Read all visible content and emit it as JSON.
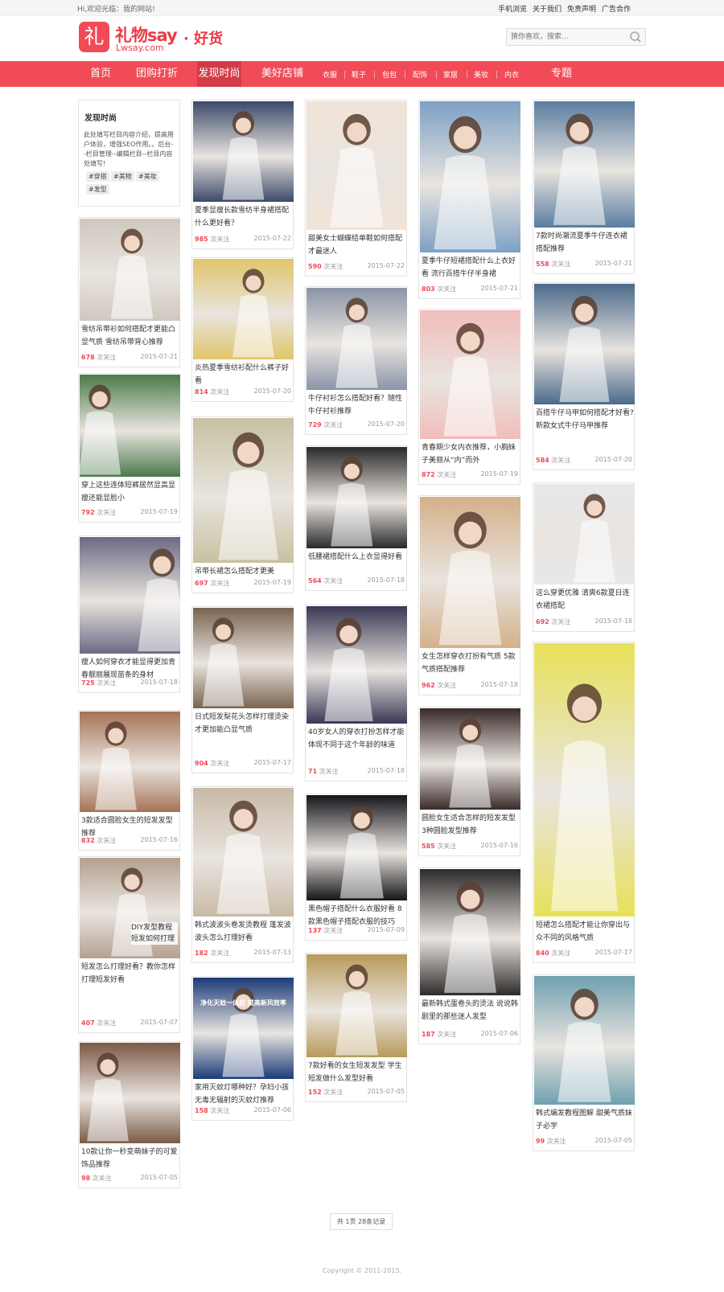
{
  "topbar": {
    "welcome": "Hi,欢迎光临：我的网站!",
    "links": [
      "手机浏览",
      "关于我们",
      "免责声明",
      "广告合作"
    ]
  },
  "header": {
    "logo_char": "礼",
    "logo_main": "礼物say",
    "logo_sub": "· 好货",
    "logo_domain": "Lwsay.com",
    "search_placeholder": "猜你喜欢，搜索...",
    "colors": {
      "brand": "#f04b57",
      "accent": "#d33c46"
    }
  },
  "nav": {
    "home": "首页",
    "group": "团购打折",
    "discover": "发现时尚",
    "shops": "美好店铺",
    "cats": [
      "衣服",
      "鞋子",
      "包包",
      "配饰",
      "家居",
      "美妆",
      "内衣"
    ],
    "special": "专题"
  },
  "sidebar": {
    "title": "发现时尚",
    "desc": "此处填写栏目内容介绍，提高用户体验，增强SEO作用。。后台--栏目管理--编辑栏目--栏目内容处填写!",
    "tags": [
      "#穿搭",
      "#美物",
      "#美妆",
      "#发型"
    ]
  },
  "unit": "次关注",
  "feed": {
    "col1": [
      {
        "title": "雪纺吊带衫如何搭配才更能凸显气质 雪纺吊带背心推荐",
        "count": "678",
        "date": "2015-07-21"
      },
      {
        "title": "穿上这些连体短裤居然显高显瘦还能显脸小",
        "count": "792",
        "date": "2015-07-19"
      },
      {
        "title": "瘦人如何穿衣才能显得更加青春靓丽展现苗条的身材",
        "count": "725",
        "date": "2015-07-18"
      },
      {
        "title": "3款适合圆脸女生的短发发型推荐",
        "count": "832",
        "date": "2015-07-16"
      },
      {
        "title": "短发怎么打理好看？教你怎样打理短发好看",
        "count": "407",
        "date": "2015-07-07",
        "overlay": "DIY发型教程 短发如何打理"
      },
      {
        "title": "10款让你一秒变萌妹子的可爱饰品推荐",
        "count": "98",
        "date": "2015-07-05"
      }
    ],
    "col2": [
      {
        "title": "夏季显瘦长款雪纺半身裙搭配什么更好看？",
        "count": "985",
        "date": "2015-07-22"
      },
      {
        "title": "炎热夏季雪纺衫配什么裤子好看",
        "count": "814",
        "date": "2015-07-20"
      },
      {
        "title": "吊带长裙怎么搭配才更美",
        "count": "697",
        "date": "2015-07-19"
      },
      {
        "title": "日式短发梨花头怎样打理烫染才更加能凸显气质",
        "count": "904",
        "date": "2015-07-17"
      },
      {
        "title": "韩式波波头卷发烫教程 蓬发波波头怎么打理好看",
        "count": "182",
        "date": "2015-07-13"
      },
      {
        "title": "家用灭蚊灯哪种好？孕妇小孩无毒无辐射的灭蚊灯推荐",
        "count": "158",
        "date": "2015-07-06",
        "ad_text": "净化灭蚊一体机 提高新风效率"
      }
    ],
    "col3": [
      {
        "title": "甜美女士蝴蝶结单鞋如何搭配才最迷人",
        "count": "590",
        "date": "2015-07-22"
      },
      {
        "title": "牛仔衬衫怎么搭配好看？随性牛仔衬衫推荐",
        "count": "729",
        "date": "2015-07-20"
      },
      {
        "title": "低腰裙搭配什么上衣显得好看",
        "count": "564",
        "date": "2015-07-18"
      },
      {
        "title": "40岁女人的穿衣打扮怎样才能体现不同于这个年龄的味道",
        "count": "71",
        "date": "2015-07-18"
      },
      {
        "title": "黑色帽子搭配什么衣服好看 8款黑色帽子搭配衣服的技巧",
        "count": "137",
        "date": "2015-07-09"
      },
      {
        "title": "7款好看的女生短发发型 学生短发做什么发型好看",
        "count": "152",
        "date": "2015-07-05"
      }
    ],
    "col4": [
      {
        "title": "夏季牛仔短裙搭配什么上衣好看 流行百搭牛仔半身裙",
        "count": "803",
        "date": "2015-07-21"
      },
      {
        "title": "青春期少女内衣推荐，小胸妹子美丽从“内”而外",
        "count": "872",
        "date": "2015-07-19"
      },
      {
        "title": "女生怎样穿衣打扮有气质 5款气质搭配推荐",
        "count": "962",
        "date": "2015-07-18"
      },
      {
        "title": "圆脸女生适合怎样的短发发型 3种圆脸发型推荐",
        "count": "585",
        "date": "2015-07-16"
      },
      {
        "title": "最新韩式蛋卷头的烫法 说说韩剧里的那些迷人发型",
        "count": "187",
        "date": "2015-07-06"
      }
    ],
    "col5": [
      {
        "title": "7款时尚潮流夏季牛仔连衣裙搭配推荐",
        "count": "558",
        "date": "2015-07-21"
      },
      {
        "title": "百搭牛仔马甲如何搭配才好看?新款女式牛仔马甲推荐",
        "count": "584",
        "date": "2015-07-20"
      },
      {
        "title": "这么穿更优雅 清爽6款夏日连衣裙搭配",
        "count": "692",
        "date": "2015-07-18"
      },
      {
        "title": "短裙怎么搭配才能让你穿出与众不同的风格气质",
        "count": "840",
        "date": "2015-07-17"
      },
      {
        "title": "韩式编发教程图解 甜美气质妹子必学",
        "count": "99",
        "date": "2015-07-05"
      }
    ]
  },
  "pager": "共 1页 28条记录",
  "footer": {
    "copyright": "Copyright © 2011-2015."
  }
}
